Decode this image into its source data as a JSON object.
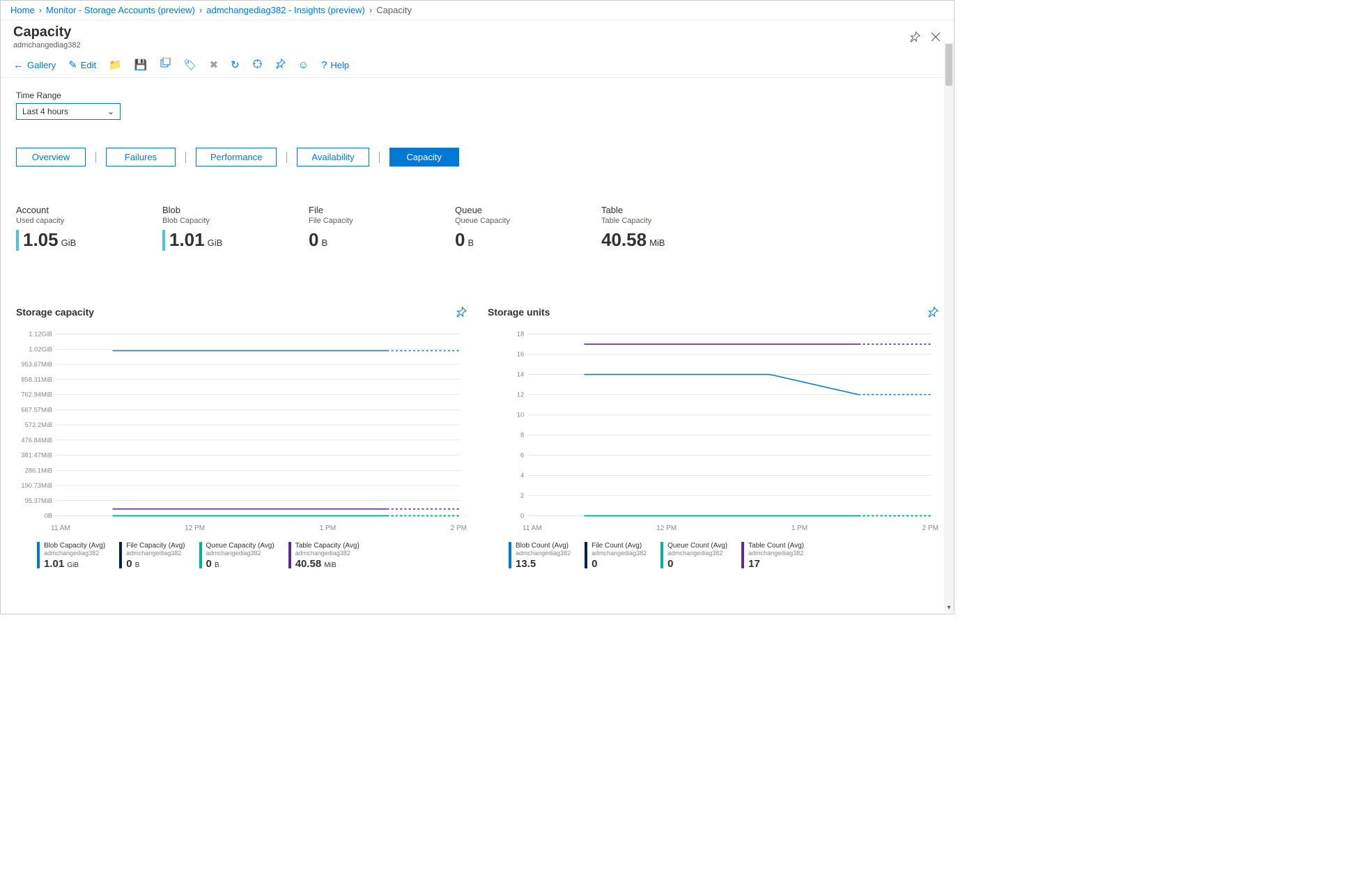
{
  "breadcrumb": {
    "items": [
      "Home",
      "Monitor - Storage Accounts (preview)",
      "admchangediag382 - Insights (preview)"
    ],
    "current": "Capacity"
  },
  "header": {
    "title": "Capacity",
    "subtitle": "admchangediag382"
  },
  "toolbar": {
    "gallery": "Gallery",
    "edit": "Edit",
    "help": "Help"
  },
  "time_range": {
    "label": "Time Range",
    "value": "Last 4 hours"
  },
  "tabs": [
    "Overview",
    "Failures",
    "Performance",
    "Availability",
    "Capacity"
  ],
  "active_tab": "Capacity",
  "metrics": [
    {
      "title": "Account",
      "sub": "Used capacity",
      "value": "1.05",
      "unit": "GiB",
      "accent": true
    },
    {
      "title": "Blob",
      "sub": "Blob Capacity",
      "value": "1.01",
      "unit": "GiB",
      "accent": true
    },
    {
      "title": "File",
      "sub": "File Capacity",
      "value": "0",
      "unit": "B",
      "accent": false
    },
    {
      "title": "Queue",
      "sub": "Queue Capacity",
      "value": "0",
      "unit": "B",
      "accent": false
    },
    {
      "title": "Table",
      "sub": "Table Capacity",
      "value": "40.58",
      "unit": "MiB",
      "accent": false
    }
  ],
  "colors": {
    "blue": "#0078d4",
    "navy": "#002050",
    "teal": "#00B294",
    "purple": "#5c2d91"
  },
  "chart_data": [
    {
      "type": "line",
      "title": "Storage capacity",
      "x_ticks": [
        "11 AM",
        "12 PM",
        "1 PM",
        "2 PM"
      ],
      "y_ticks": [
        "1.12GiB",
        "1.02GiB",
        "953.67MiB",
        "858.31MiB",
        "762.94MiB",
        "667.57MiB",
        "572.2MiB",
        "476.84MiB",
        "381.47MiB",
        "286.1MiB",
        "190.73MiB",
        "95.37MiB",
        "0B"
      ],
      "series": [
        {
          "name": "Blob Capacity (Avg)",
          "sub": "admchangediag382",
          "value": "1.01",
          "unit": "GiB",
          "color": "blue",
          "flat_at": "1.01GiB"
        },
        {
          "name": "File Capacity (Avg)",
          "sub": "admchangediag382",
          "value": "0",
          "unit": "B",
          "color": "navy",
          "flat_at": "0B"
        },
        {
          "name": "Queue Capacity (Avg)",
          "sub": "admchangediag382",
          "value": "0",
          "unit": "B",
          "color": "teal",
          "flat_at": "0B"
        },
        {
          "name": "Table Capacity (Avg)",
          "sub": "admchangediag382",
          "value": "40.58",
          "unit": "MiB",
          "color": "purple",
          "flat_at": "40.58MiB"
        }
      ]
    },
    {
      "type": "line",
      "title": "Storage units",
      "x_ticks": [
        "11 AM",
        "12 PM",
        "1 PM",
        "2 PM"
      ],
      "y_ticks": [
        "18",
        "16",
        "14",
        "12",
        "10",
        "8",
        "6",
        "4",
        "2",
        "0"
      ],
      "series": [
        {
          "name": "Blob Count (Avg)",
          "sub": "admchangediag382",
          "value": "13.5",
          "unit": "",
          "color": "blue",
          "points": [
            14,
            14,
            14,
            12
          ]
        },
        {
          "name": "File Count (Avg)",
          "sub": "admchangediag382",
          "value": "0",
          "unit": "",
          "color": "navy",
          "flat_at": 0
        },
        {
          "name": "Queue Count (Avg)",
          "sub": "admchangediag382",
          "value": "0",
          "unit": "",
          "color": "teal",
          "flat_at": 0
        },
        {
          "name": "Table Count (Avg)",
          "sub": "admchangediag382",
          "value": "17",
          "unit": "",
          "color": "purple",
          "flat_at": 17
        }
      ]
    }
  ]
}
